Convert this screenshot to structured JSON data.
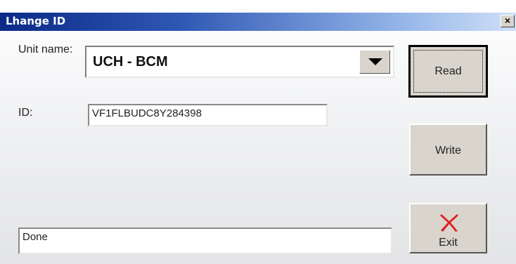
{
  "window": {
    "title": "Lhange ID",
    "close_glyph": "×"
  },
  "form": {
    "unit_label": "Unit name:",
    "unit_value": "UCH - BCM",
    "id_label": "ID:",
    "id_value": "VF1FLBUDC8Y284398",
    "status_text": "Done"
  },
  "buttons": {
    "read_label": "Read",
    "write_label": "Write",
    "exit_label": "Exit",
    "exit_icon": "red-x-icon"
  },
  "colors": {
    "titlebar_start": "#0a2a86",
    "titlebar_end": "#cfe0f8",
    "exit_icon_red": "#e02020"
  }
}
